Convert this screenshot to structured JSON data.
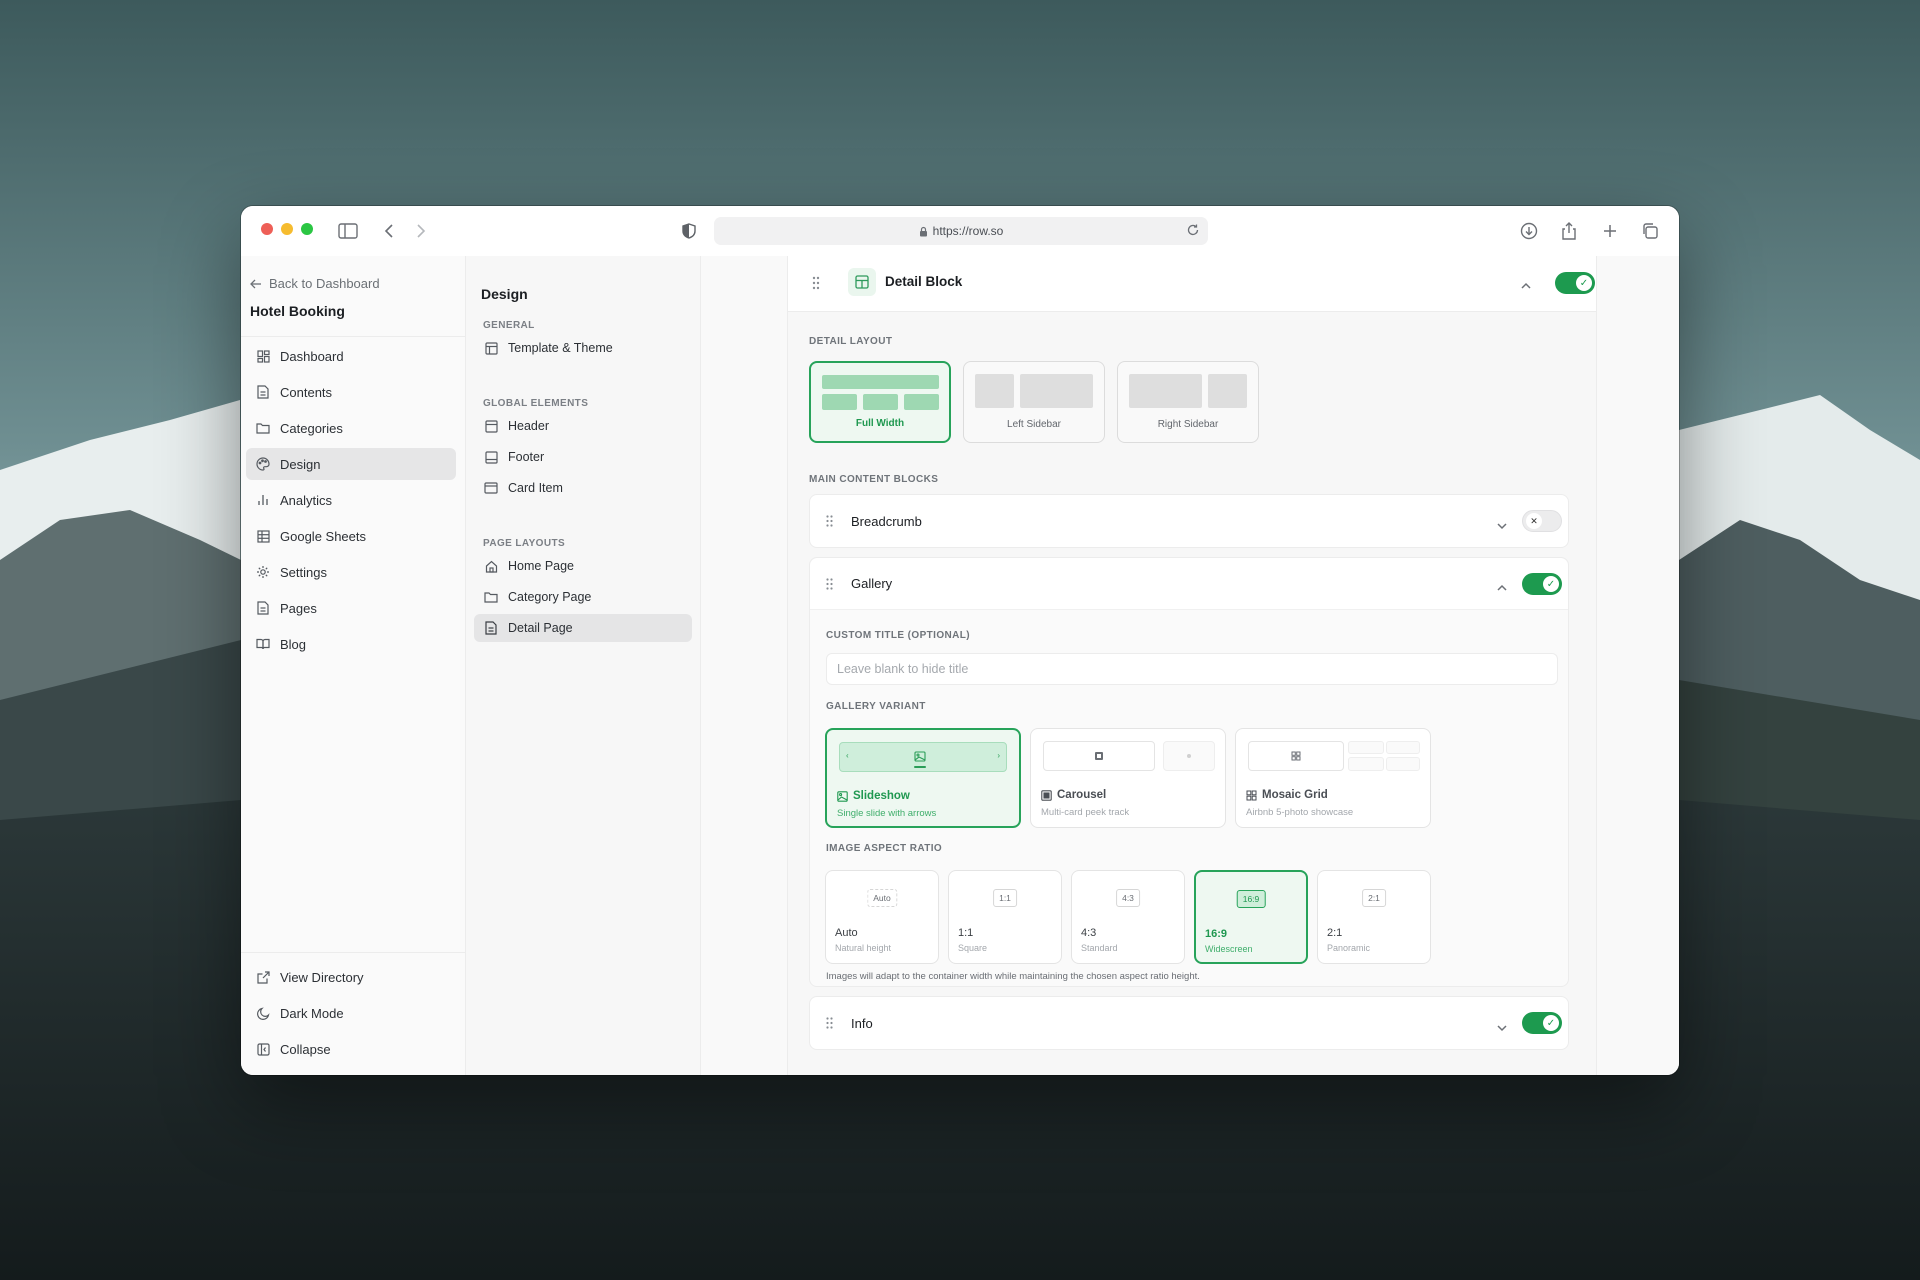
{
  "browser": {
    "url": "https://row.so"
  },
  "sidebar": {
    "back_label": "Back to Dashboard",
    "app_title": "Hotel Booking",
    "items": [
      {
        "label": "Dashboard",
        "icon": "dashboard-icon"
      },
      {
        "label": "Contents",
        "icon": "document-icon"
      },
      {
        "label": "Categories",
        "icon": "folder-icon"
      },
      {
        "label": "Design",
        "icon": "palette-icon",
        "active": true
      },
      {
        "label": "Analytics",
        "icon": "bar-chart-icon"
      },
      {
        "label": "Google Sheets",
        "icon": "table-icon"
      },
      {
        "label": "Settings",
        "icon": "gear-icon"
      },
      {
        "label": "Pages",
        "icon": "page-icon"
      },
      {
        "label": "Blog",
        "icon": "book-icon"
      }
    ],
    "bottom_items": [
      {
        "label": "View Directory",
        "icon": "external-link-icon"
      },
      {
        "label": "Dark Mode",
        "icon": "moon-icon"
      },
      {
        "label": "Collapse",
        "icon": "collapse-icon"
      }
    ]
  },
  "subnav": {
    "title": "Design",
    "sections": [
      {
        "label": "GENERAL",
        "items": [
          {
            "label": "Template & Theme",
            "icon": "layout-icon"
          }
        ]
      },
      {
        "label": "GLOBAL ELEMENTS",
        "items": [
          {
            "label": "Header",
            "icon": "header-icon"
          },
          {
            "label": "Footer",
            "icon": "footer-icon"
          },
          {
            "label": "Card Item",
            "icon": "card-icon"
          }
        ]
      },
      {
        "label": "PAGE LAYOUTS",
        "items": [
          {
            "label": "Home Page",
            "icon": "home-icon"
          },
          {
            "label": "Category Page",
            "icon": "folder-icon"
          },
          {
            "label": "Detail Page",
            "icon": "page-icon",
            "active": true
          }
        ]
      }
    ]
  },
  "detail_block": {
    "title": "Detail Block",
    "enabled": true,
    "layout_label": "DETAIL LAYOUT",
    "layouts": [
      "Full Width",
      "Left Sidebar",
      "Right Sidebar"
    ],
    "selected_layout": "Full Width",
    "main_blocks_label": "MAIN CONTENT BLOCKS",
    "blocks": {
      "breadcrumb": {
        "title": "Breadcrumb",
        "enabled": false
      },
      "gallery": {
        "title": "Gallery",
        "enabled": true,
        "custom_title_label": "CUSTOM TITLE (OPTIONAL)",
        "custom_title_placeholder": "Leave blank to hide title",
        "variant_label": "GALLERY VARIANT",
        "variants": [
          {
            "name": "Slideshow",
            "desc": "Single slide with arrows"
          },
          {
            "name": "Carousel",
            "desc": "Multi-card peek track"
          },
          {
            "name": "Mosaic Grid",
            "desc": "Airbnb 5-photo showcase"
          }
        ],
        "selected_variant": "Slideshow",
        "ratio_label": "IMAGE ASPECT RATIO",
        "ratios": [
          {
            "chip": "Auto",
            "name": "Auto",
            "desc": "Natural height"
          },
          {
            "chip": "1:1",
            "name": "1:1",
            "desc": "Square"
          },
          {
            "chip": "4:3",
            "name": "4:3",
            "desc": "Standard"
          },
          {
            "chip": "16:9",
            "name": "16:9",
            "desc": "Widescreen"
          },
          {
            "chip": "2:1",
            "name": "2:1",
            "desc": "Panoramic"
          }
        ],
        "selected_ratio": "16:9",
        "note": "Images will adapt to the container width while maintaining the chosen aspect ratio height."
      },
      "info": {
        "title": "Info",
        "enabled": true
      }
    }
  },
  "colors": {
    "accent": "#1d9a4f",
    "accent_light": "#eef8f1"
  }
}
